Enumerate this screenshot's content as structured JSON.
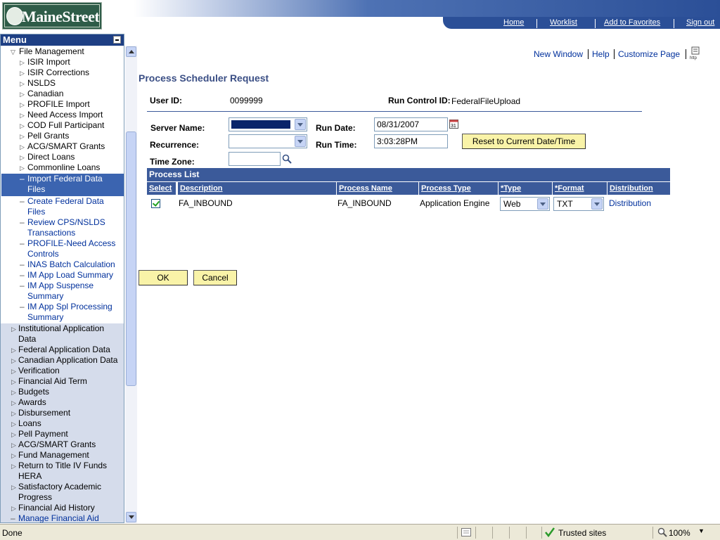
{
  "header": {
    "logo_text": "MaineStreet",
    "links": [
      "Home",
      "Worklist",
      "Add to Favorites",
      "Sign out"
    ]
  },
  "menu": {
    "title": "Menu",
    "file_management": "File Management",
    "file_items": [
      "ISIR Import",
      "ISIR Corrections",
      "NSLDS",
      "Canadian",
      "PROFILE Import",
      "Need Access Import",
      "COD Full Participant",
      "Pell Grants",
      "ACG/SMART Grants",
      "Direct Loans",
      "Commonline Loans"
    ],
    "selected_item": [
      "Import Federal Data",
      "Files"
    ],
    "link_items": [
      [
        "Create Federal Data",
        "Files"
      ],
      [
        "Review CPS/NSLDS",
        "Transactions"
      ],
      [
        "PROFILE-Need Access",
        "Controls"
      ],
      [
        "INAS Batch Calculation"
      ],
      [
        "IM App Load Summary"
      ],
      [
        "IM App Suspense",
        "Summary"
      ],
      [
        "IM App Spl Processing",
        "Summary"
      ]
    ],
    "lower_items": [
      [
        "Institutional Application",
        "Data"
      ],
      [
        "Federal Application Data"
      ],
      [
        "Canadian Application Data"
      ],
      [
        "Verification"
      ],
      [
        "Financial Aid Term"
      ],
      [
        "Budgets"
      ],
      [
        "Awards"
      ],
      [
        "Disbursement"
      ],
      [
        "Loans"
      ],
      [
        "Pell Payment"
      ],
      [
        "ACG/SMART Grants"
      ],
      [
        "Fund Management"
      ],
      [
        "Return to Title IV Funds",
        "HERA"
      ],
      [
        "Satisfactory Academic",
        "Progress"
      ],
      [
        "Financial Aid History"
      ]
    ],
    "last_link": "Manage Financial Aid"
  },
  "toplinks": [
    "New Window",
    "Help",
    "Customize Page"
  ],
  "page": {
    "title": "Process Scheduler Request",
    "user_id_label": "User ID:",
    "user_id": "0099999",
    "run_control_label": "Run Control ID:",
    "run_control": "FederalFileUpload",
    "server_name_label": "Server Name:",
    "run_date_label": "Run Date:",
    "run_date": "08/31/2007",
    "recurrence_label": "Recurrence:",
    "run_time_label": "Run Time:",
    "run_time": "3:03:28PM",
    "reset_button": "Reset to Current Date/Time",
    "time_zone_label": "Time Zone:",
    "ok_button": "OK",
    "cancel_button": "Cancel"
  },
  "process_list": {
    "title": "Process List",
    "headers": [
      "Select",
      "Description",
      "Process Name",
      "Process Type",
      "*Type",
      "*Format",
      "Distribution"
    ],
    "row": {
      "description": "FA_INBOUND",
      "process_name": "FA_INBOUND",
      "process_type": "Application Engine",
      "type": "Web",
      "format": "TXT",
      "distribution": "Distribution"
    }
  },
  "status_bar": {
    "text": "Done",
    "zone": "Trusted sites",
    "zoom": "100%"
  }
}
